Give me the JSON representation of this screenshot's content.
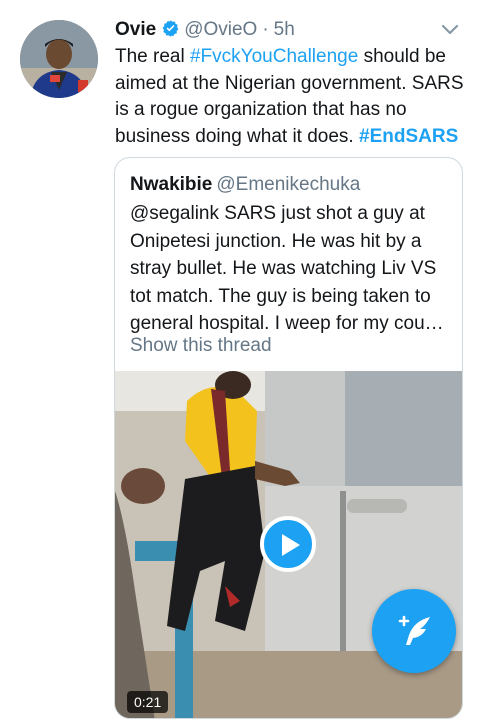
{
  "tweet": {
    "author_name": "Ovie",
    "author_handle": "@OvieO",
    "separator": "·",
    "time": "5h",
    "text_before": "The real ",
    "hashtag_1": "#FvckYouChallenge",
    "text_middle": " should be aimed at the Nigerian government. SARS is a rogue organization that has no business doing what it does. ",
    "hashtag_2": "#EndSARS"
  },
  "quoted_tweet": {
    "author_name": "Nwakibie",
    "author_handle": "@Emenikechuka",
    "text": "@segalink SARS just shot a guy at Onipetesi junction. He was hit by a stray bullet. He was watching Liv VS tot match. The guy is being taken to general hospital. I weep for my cou…",
    "show_thread_label": "Show this thread",
    "video_duration": "0:21"
  },
  "icons": {
    "verified": "verified-badge-icon",
    "caret": "chevron-down-icon",
    "play": "play-icon",
    "compose": "compose-tweet-icon"
  },
  "colors": {
    "accent": "#1da1f2",
    "text_primary": "#14171a",
    "text_secondary": "#657786"
  }
}
